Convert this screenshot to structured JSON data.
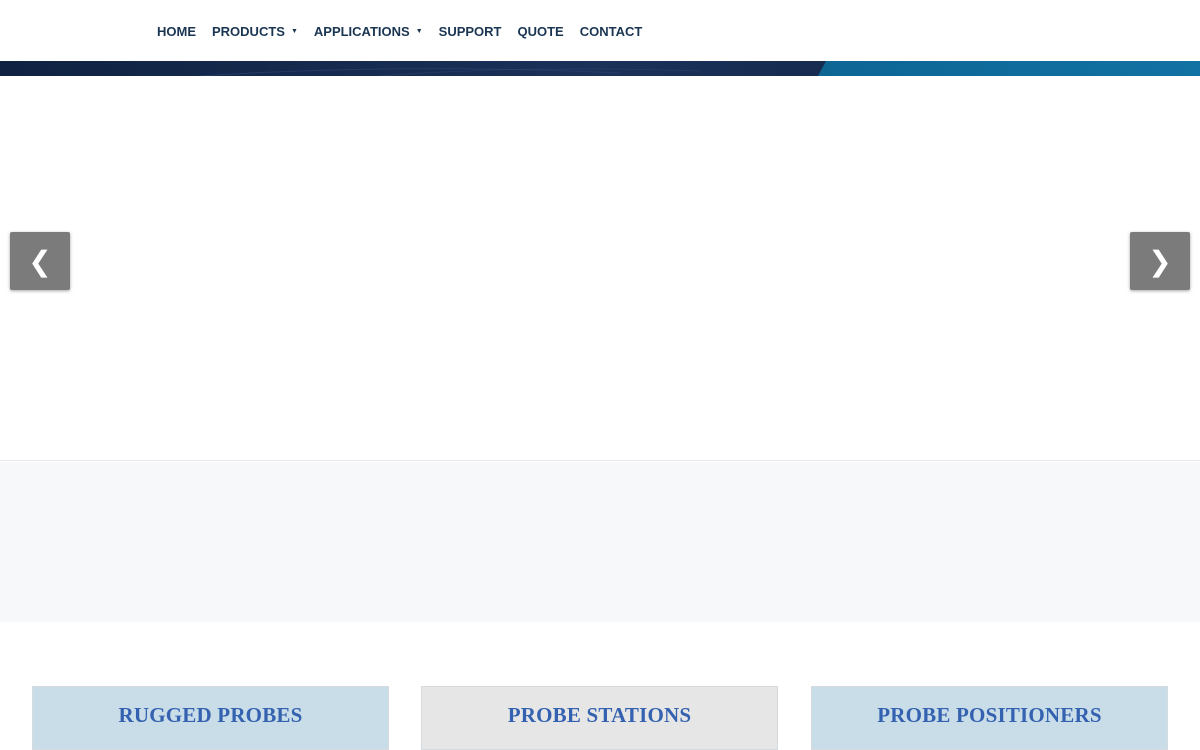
{
  "nav": {
    "items": [
      {
        "label": "HOME",
        "has_dropdown": false
      },
      {
        "label": "PRODUCTS",
        "has_dropdown": true
      },
      {
        "label": "APPLICATIONS",
        "has_dropdown": true
      },
      {
        "label": "SUPPORT",
        "has_dropdown": false
      },
      {
        "label": "QUOTE",
        "has_dropdown": false
      },
      {
        "label": "CONTACT",
        "has_dropdown": false
      }
    ],
    "dropdown_caret": "▼"
  },
  "slider": {
    "prev_arrow": "❮",
    "next_arrow": "❯"
  },
  "cards": [
    {
      "title": "RUGGED PROBES"
    },
    {
      "title": "PROBE STATIONS"
    },
    {
      "title": "PROBE POSITIONERS"
    }
  ],
  "colors": {
    "nav_text": "#1a3552",
    "banner_dark": "#0f2242",
    "banner_accent": "#0f6b98",
    "card_blue": "#c9dde9",
    "card_gray": "#e6e6e6",
    "card_title": "#3462b0",
    "arrow_bg": "#7b7b7b"
  }
}
